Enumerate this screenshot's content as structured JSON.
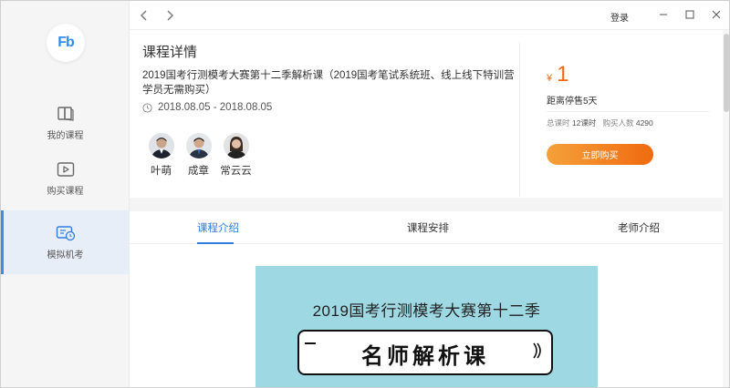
{
  "app": {
    "logo_text": "Fb",
    "accent_color": "#2f7de1",
    "price_color": "#f06a0f"
  },
  "sidebar": {
    "items": [
      {
        "label": "我的课程",
        "icon": "book-icon",
        "active": false
      },
      {
        "label": "购买课程",
        "icon": "play-icon",
        "active": false
      },
      {
        "label": "模拟机考",
        "icon": "exam-clock-icon",
        "active": true
      }
    ]
  },
  "titlebar": {
    "back_icon": "chevron-left-icon",
    "forward_icon": "chevron-right-icon",
    "login_label": "登录",
    "minimize_icon": "minimize-icon",
    "maximize_icon": "maximize-icon",
    "close_icon": "close-icon"
  },
  "course": {
    "page_title": "课程详情",
    "description": "2019国考行测模考大赛第十二季解析课（2019国考笔试系统班、线上线下特训营学员无需购买）",
    "date_range": "2018.08.05 - 2018.08.05",
    "teachers": [
      {
        "name": "叶萌"
      },
      {
        "name": "成章"
      },
      {
        "name": "常云云"
      }
    ]
  },
  "purchase": {
    "currency_symbol": "¥",
    "price": "1",
    "countdown": "距离停售5天",
    "total_label": "总课时",
    "total_value": "12课时",
    "buyers_label": "购买人数",
    "buyers_value": "4290",
    "buy_label": "立即购买"
  },
  "tabs": [
    {
      "label": "课程介绍",
      "active": true
    },
    {
      "label": "课程安排",
      "active": false
    },
    {
      "label": "老师介绍",
      "active": false
    }
  ],
  "banner": {
    "title": "2019国考行测模考大赛第十二季",
    "scroll_text": "名师解析课"
  }
}
